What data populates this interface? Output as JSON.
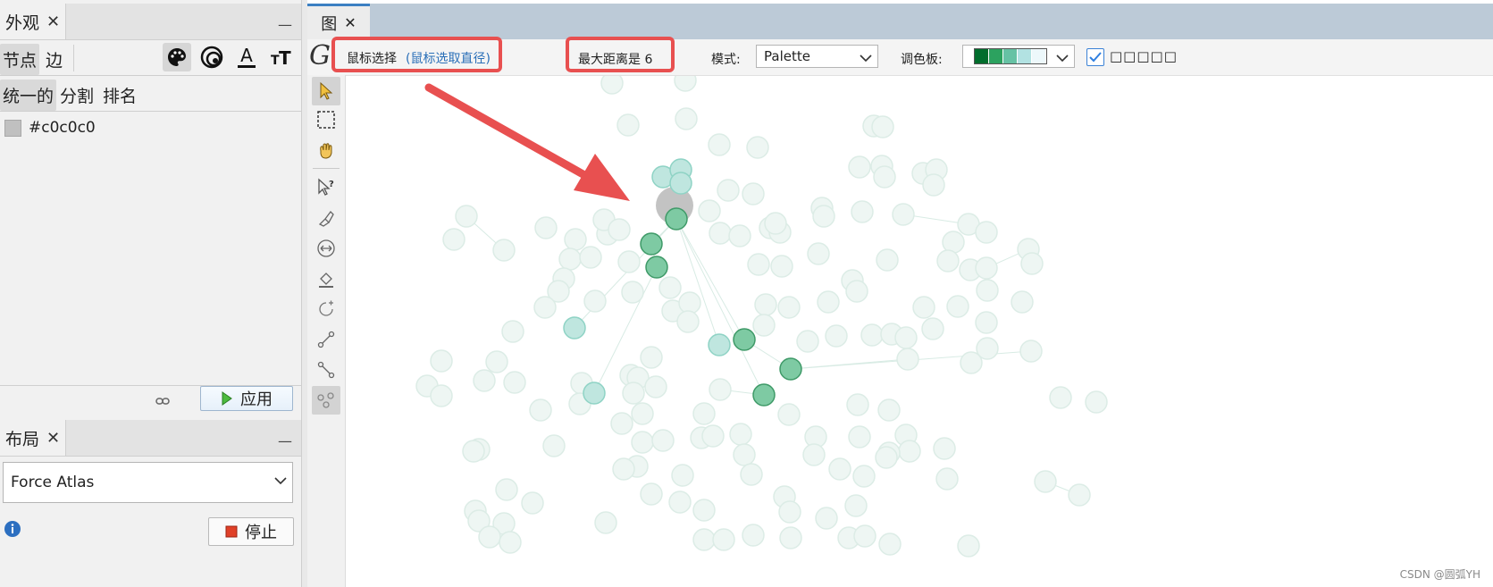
{
  "appearance_panel": {
    "tab_title": "外观",
    "close_glyph": "✕",
    "minimize_glyph": "—",
    "element_tabs": [
      "节点",
      "边"
    ],
    "mode_tabs": [
      "统一的",
      "分割",
      "排名"
    ],
    "color_value": "#c0c0c0",
    "apply_label": "应用",
    "icons": [
      "palette-icon",
      "size-icon",
      "label-color-icon",
      "label-size-icon"
    ]
  },
  "layout_panel": {
    "tab_title": "布局",
    "close_glyph": "✕",
    "minimize_glyph": "—",
    "algorithm": "Force Atlas",
    "stop_label": "停止"
  },
  "graph_window": {
    "tab_title": "图",
    "close_glyph": "✕",
    "toolbar": {
      "logo": "G",
      "mouse_select": "鼠标选择",
      "mouse_select_hint": "(鼠标选取直径)",
      "max_distance": "最大距离是 6",
      "mode_label": "模式:",
      "mode_value": "Palette",
      "palette_label": "调色板:",
      "palette_colors": [
        "#006d2c",
        "#2ca25f",
        "#66c2a4",
        "#b2e2e2",
        "#edf8fb"
      ],
      "checkbox_checked": true,
      "checkbox_text": "□□□□□"
    },
    "colors": {
      "accent_red": "#e85050",
      "node_faded": "#eef6f3",
      "node_highlight": "#7ecaa3",
      "node_light": "#bfe6df"
    }
  },
  "watermark": "CSDN @圆弧YH"
}
